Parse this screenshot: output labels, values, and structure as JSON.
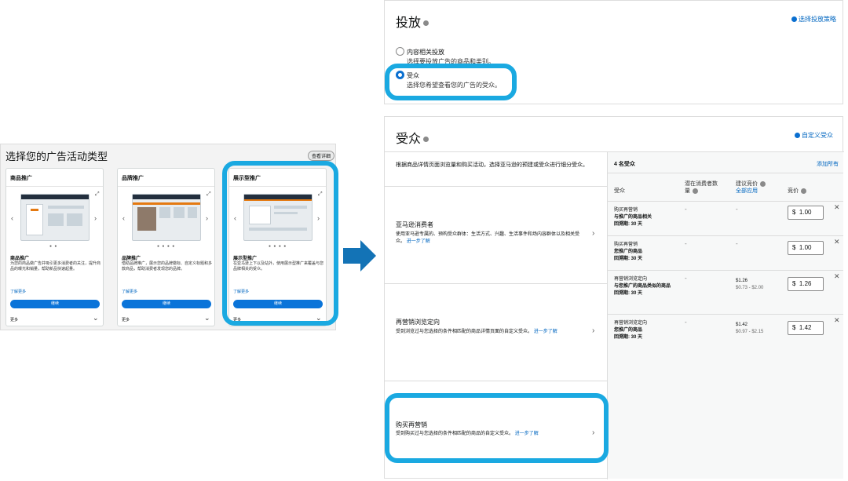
{
  "left": {
    "title": "选择您的广告活动类型",
    "help": "查看详细",
    "cards": [
      {
        "title": "商品推广",
        "name": "商品推广",
        "desc": "为您的商品做广告并吸引更多消费者的关注，提升商品的曝光和销量，帮助新品快速起量。",
        "link": "了解更多",
        "button": "继续",
        "more": "更多"
      },
      {
        "title": "品牌推广",
        "name": "品牌推广",
        "desc": "借助品牌推广，展示您的品牌徽标、自定义标题和多款商品，帮助消费者发现您的品牌。",
        "link": "了解更多",
        "button": "继续",
        "more": "更多"
      },
      {
        "title": "展示型推广",
        "name": "展示型推广",
        "desc": "在亚马逊上下以及站外，使用展示型推广来覆盖与您品牌相关的受众。",
        "link": "了解更多",
        "button": "继续",
        "more": "更多"
      }
    ]
  },
  "placement": {
    "title": "投放",
    "link": "选择投放策略",
    "options": [
      {
        "label": "内容相关投放",
        "desc": "选择要投放广告的商品和类别。"
      },
      {
        "label": "受众",
        "desc": "选择您希望查看您的广告的受众。"
      }
    ]
  },
  "audience": {
    "title": "受众",
    "link": "自定义受众",
    "intro": "根据商品详情页面浏览量和购买活动，选择亚马逊的预建或受众进行细分受众。",
    "categories": [
      {
        "title": "亚马逊消费者",
        "desc": "使用亚马逊专属的、预构受众群体：生活方式、兴趣、生活事件和场内容群体以及相关受众。",
        "link": "进一步了解"
      },
      {
        "title": "再营销浏览定向",
        "desc": "受到浏览过与您选择的条件相匹配的商品详情页面的自定义受众。",
        "link": "进一步了解"
      },
      {
        "title": "购买再营销",
        "desc": "受到购买过与您选择的条件相匹配的商品的自定义受众。",
        "link": "进一步了解"
      }
    ],
    "table": {
      "count": "4 名受众",
      "add_all": "添加所有",
      "headers": {
        "audience": "受众",
        "reach": "潜在消费者数量",
        "suggested": "建议竞价",
        "apply_all": "全部应用",
        "bid": "竞价"
      },
      "rows": [
        {
          "type": "购买再营销",
          "line1": "与推广的商品相关",
          "line2": "回溯期: 30 天",
          "reach": "-",
          "suggested": "-",
          "range": "",
          "bid": "1.00"
        },
        {
          "type": "购买再营销",
          "line1": "您推广的商品",
          "line2": "回溯期: 30 天",
          "reach": "-",
          "suggested": "-",
          "range": "",
          "bid": "1.00"
        },
        {
          "type": "再营销浏览定向",
          "line1": "与您推广的商品类似的商品",
          "line2": "回溯期: 30 天",
          "reach": "-",
          "suggested": "$1.26",
          "range": "$0.73 - $2.00",
          "bid": "1.26"
        },
        {
          "type": "再营销浏览定向",
          "line1": "您推广的商品",
          "line2": "回溯期: 30 天",
          "reach": "-",
          "suggested": "$1.42",
          "range": "$0.97 - $2.15",
          "bid": "1.42"
        }
      ],
      "currency": "$"
    }
  },
  "colors": {
    "highlight": "#1aa9e1",
    "arrow": "#1373b6",
    "link": "#0066c0",
    "button": "#0a74d9"
  }
}
